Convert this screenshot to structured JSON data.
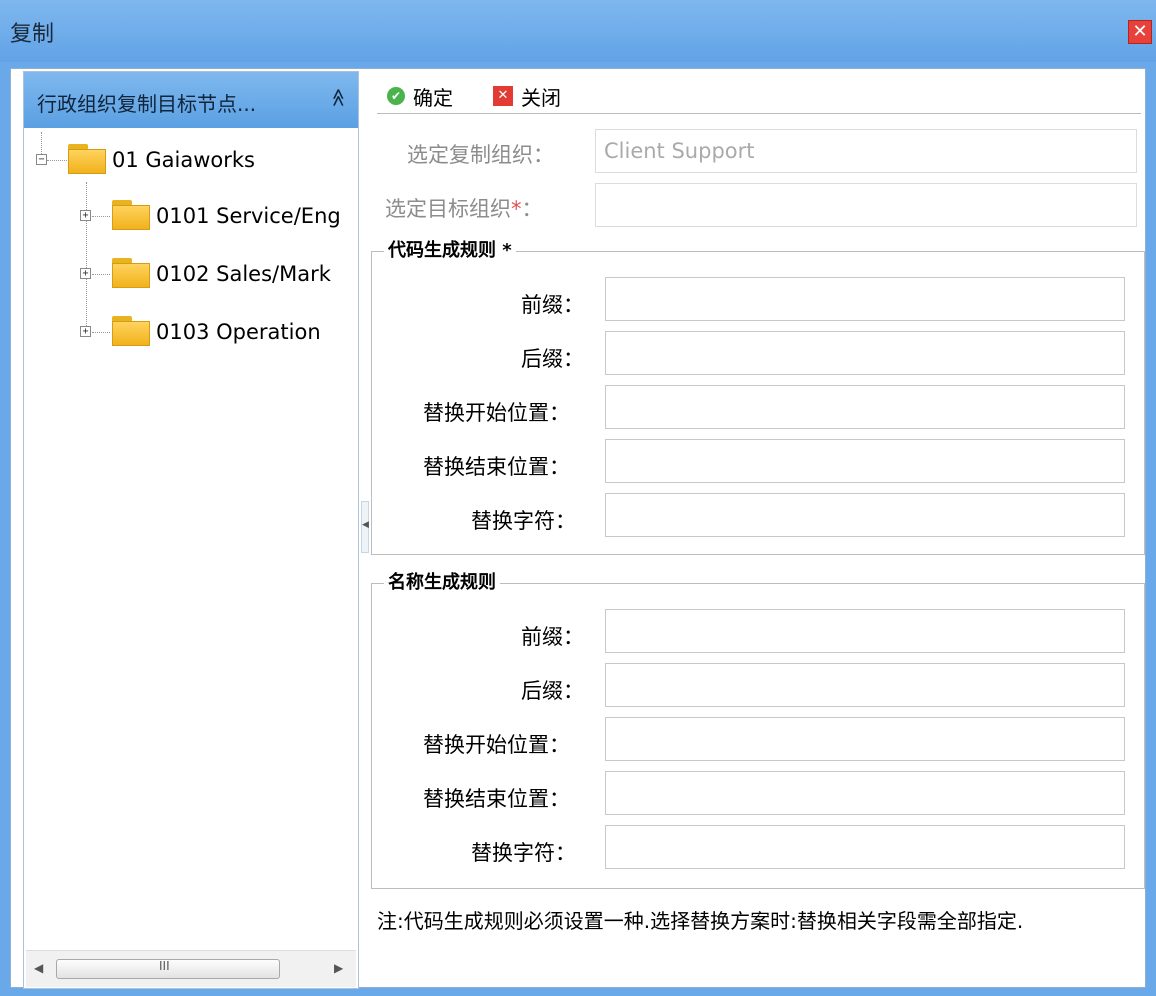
{
  "window": {
    "title": "复制",
    "close_label": "✕"
  },
  "tree_panel": {
    "header": "行政组织复制目标节点...",
    "collapse_glyph": "≫",
    "nodes": [
      {
        "label": "01 Gaiaworks",
        "expander": "−"
      },
      {
        "label": "0101 Service/Eng",
        "expander": "+"
      },
      {
        "label": "0102 Sales/Mark",
        "expander": "+"
      },
      {
        "label": "0103 Operation",
        "expander": "+"
      }
    ],
    "scroll_left": "◀",
    "scroll_right": "▶",
    "scroll_grip": "III"
  },
  "toolbar": {
    "ok_label": "确定",
    "close_label": "关闭"
  },
  "form": {
    "source_org_label": "选定复制组织：",
    "source_org_value": "Client Support",
    "target_org_label": "选定目标组织",
    "target_org_required": "*",
    "target_org_colon": "：",
    "target_org_value": ""
  },
  "code_rule": {
    "legend": "代码生成规则 *",
    "prefix_label": "前缀：",
    "suffix_label": "后缀：",
    "replace_start_label": "替换开始位置：",
    "replace_end_label": "替换结束位置：",
    "replace_char_label": "替换字符："
  },
  "name_rule": {
    "legend": "名称生成规则",
    "prefix_label": "前缀：",
    "suffix_label": "后缀：",
    "replace_start_label": "替换开始位置：",
    "replace_end_label": "替换结束位置：",
    "replace_char_label": "替换字符："
  },
  "note": "注:代码生成规则必须设置一种.选择替换方案时:替换相关字段需全部指定."
}
